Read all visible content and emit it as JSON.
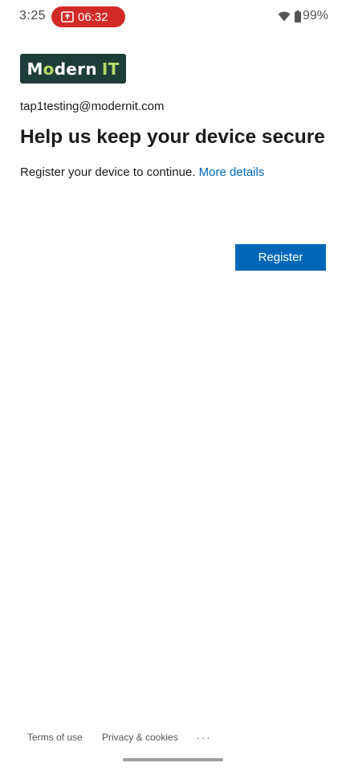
{
  "status_bar": {
    "time": "3:25",
    "recording_timer": "06:32",
    "battery": "99%",
    "record_color": "#d22a26"
  },
  "logo": {
    "text_prefix": "M",
    "text_o": "o",
    "text_suffix": "dern",
    "text_it": "IT",
    "bg_color": "#1f3d38",
    "accent_color": "#b8d968"
  },
  "account": {
    "email": "tap1testing@modernit.com"
  },
  "page": {
    "title": "Help us keep your device secure",
    "subtitle": "Register your device to continue.",
    "more_details_link": "More details"
  },
  "actions": {
    "register_label": "Register",
    "accent_color": "#0067b8"
  },
  "footer": {
    "terms": "Terms of use",
    "privacy": "Privacy & cookies",
    "more": "..."
  }
}
